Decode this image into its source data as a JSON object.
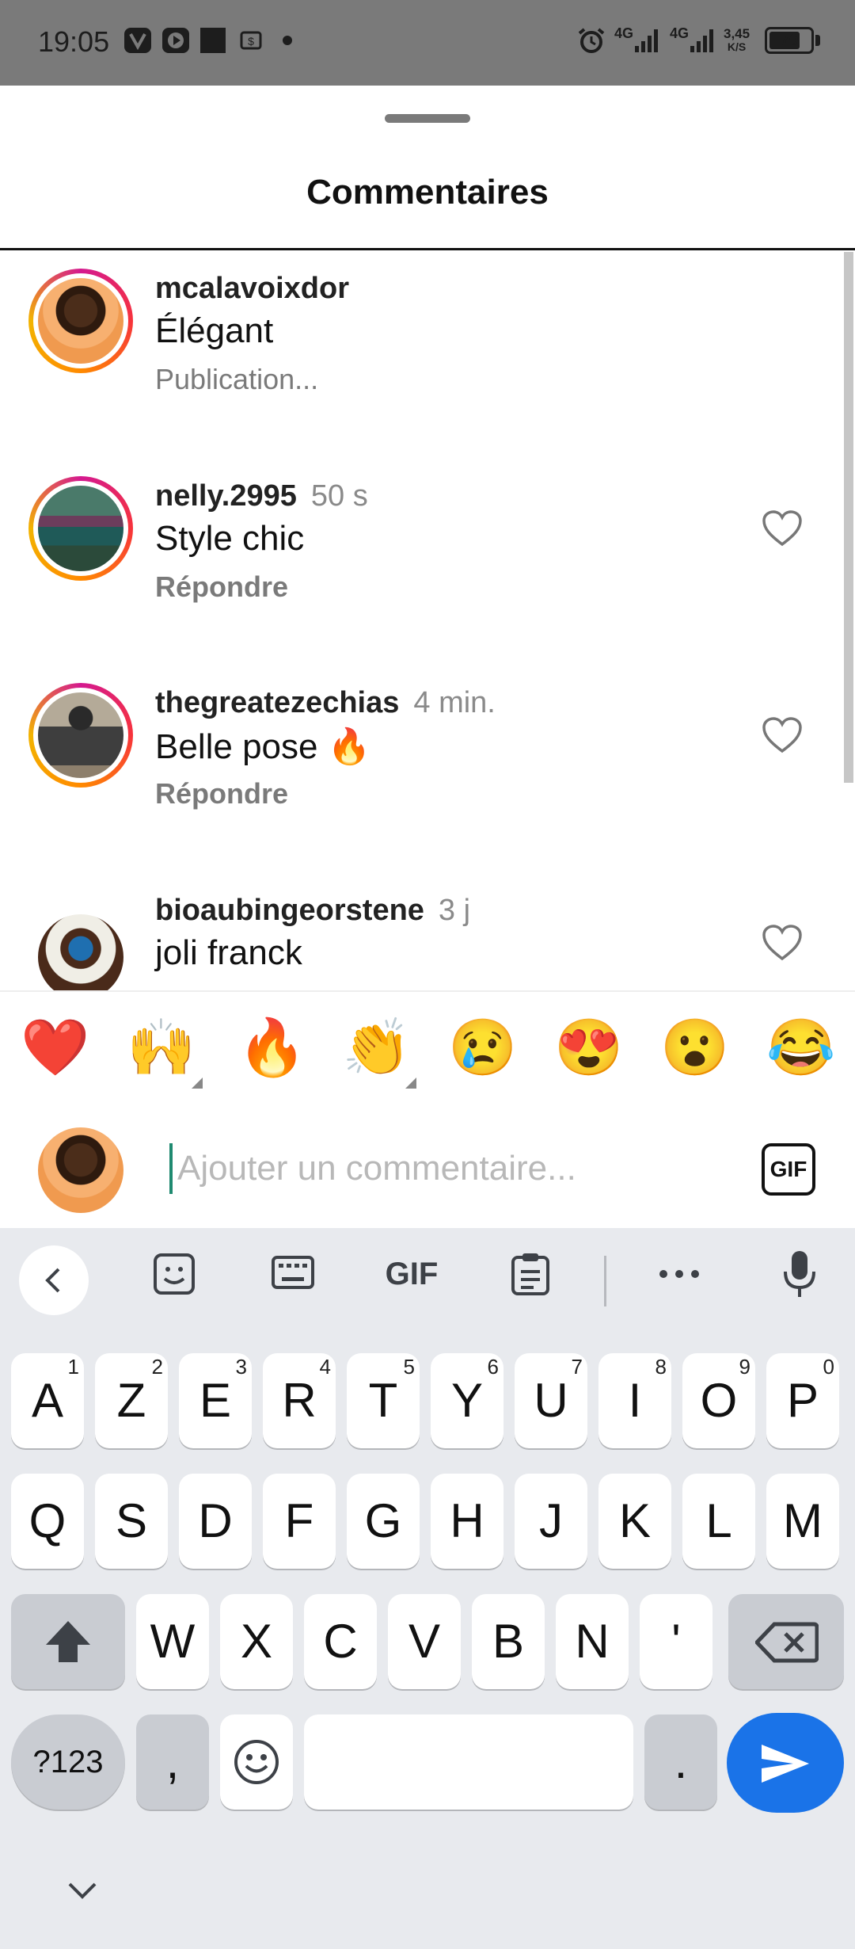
{
  "status_bar": {
    "time": "19:05",
    "signal_1": "4G",
    "signal_2": "4G",
    "speed_value": "3,45",
    "speed_unit": "K/S",
    "battery": "70"
  },
  "sheet": {
    "title": "Commentaires"
  },
  "comments": [
    {
      "username": "mcalavoixdor",
      "time": "",
      "text": "Élégant",
      "action": "Publication..."
    },
    {
      "username": "nelly.2995",
      "time": "50 s",
      "text": "Style chic",
      "action": "Répondre"
    },
    {
      "username": "thegreatezechias",
      "time": "4 min.",
      "text": "Belle pose 🔥",
      "action": "Répondre"
    },
    {
      "username": "bioaubingeorstene",
      "time": "3 j",
      "text": "joli franck",
      "action": ""
    }
  ],
  "reactions": [
    "❤️",
    "🙌",
    "🔥",
    "👏",
    "😢",
    "😍",
    "😮",
    "😂"
  ],
  "composer": {
    "placeholder": "Ajouter un commentaire...",
    "gif_label": "GIF"
  },
  "keyboard": {
    "toolbar_gif": "GIF",
    "row1": [
      {
        "key": "A",
        "hint": "1"
      },
      {
        "key": "Z",
        "hint": "2"
      },
      {
        "key": "E",
        "hint": "3"
      },
      {
        "key": "R",
        "hint": "4"
      },
      {
        "key": "T",
        "hint": "5"
      },
      {
        "key": "Y",
        "hint": "6"
      },
      {
        "key": "U",
        "hint": "7"
      },
      {
        "key": "I",
        "hint": "8"
      },
      {
        "key": "O",
        "hint": "9"
      },
      {
        "key": "P",
        "hint": "0"
      }
    ],
    "row2": [
      "Q",
      "S",
      "D",
      "F",
      "G",
      "H",
      "J",
      "K",
      "L",
      "M"
    ],
    "row3": [
      "W",
      "X",
      "C",
      "V",
      "B",
      "N",
      "'"
    ],
    "symbols_label": "?123",
    "comma_label": ",",
    "period_label": "."
  },
  "colors": {
    "accent_blue": "#1a73e8",
    "keyboard_bg": "#e8eaee",
    "status_bar_bg": "#7a7a7a"
  }
}
